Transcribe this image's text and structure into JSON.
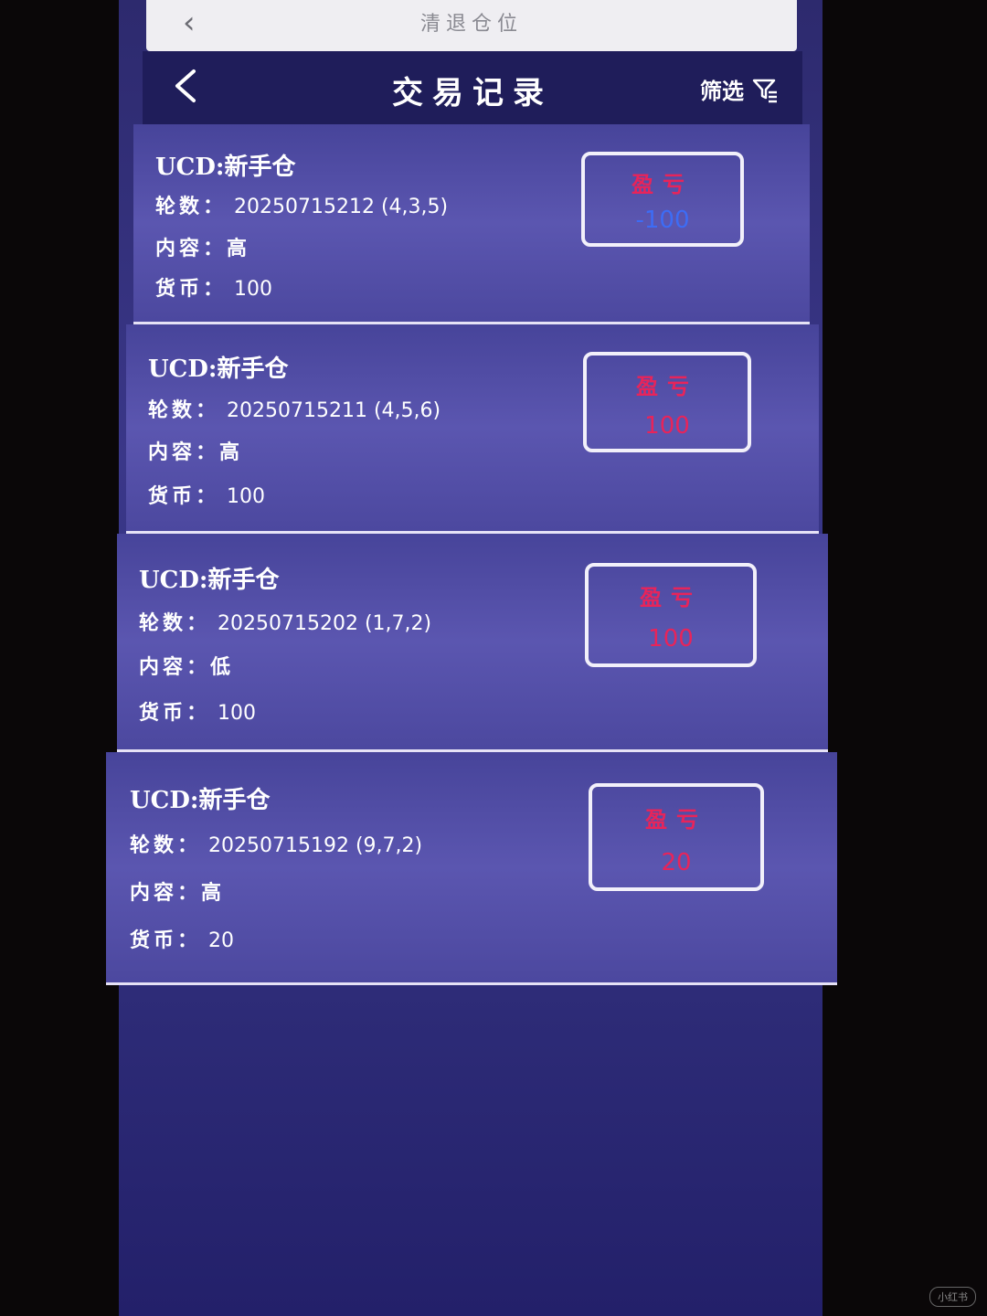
{
  "system_bar": {
    "back_icon": "chevron-left-icon",
    "title": "清退仓位"
  },
  "header": {
    "title": "交易记录",
    "filter_label": "筛选",
    "filter_icon": "filter-icon"
  },
  "records": [
    {
      "title": "UCD:新手仓",
      "round_label": "轮数：",
      "round_value": "20250715212 (4,3,5)",
      "content_label": "内容：",
      "content_value": "高",
      "currency_label": "货币：",
      "currency_value": "100",
      "pl_label": "盈亏",
      "pl_value": "-100",
      "pl_color": "#3d6cf5"
    },
    {
      "title": "UCD:新手仓",
      "round_label": "轮数：",
      "round_value": "20250715211 (4,5,6)",
      "content_label": "内容：",
      "content_value": "高",
      "currency_label": "货币：",
      "currency_value": "100",
      "pl_label": "盈亏",
      "pl_value": "100",
      "pl_color": "#e8245a"
    },
    {
      "title": "UCD:新手仓",
      "round_label": "轮数：",
      "round_value": "20250715202 (1,7,2)",
      "content_label": "内容：",
      "content_value": "低",
      "currency_label": "货币：",
      "currency_value": "100",
      "pl_label": "盈亏",
      "pl_value": "100",
      "pl_color": "#e8245a"
    },
    {
      "title": "UCD:新手仓",
      "round_label": "轮数：",
      "round_value": "20250715192 (9,7,2)",
      "content_label": "内容：",
      "content_value": "高",
      "currency_label": "货币：",
      "currency_value": "20",
      "pl_label": "盈亏",
      "pl_value": "20",
      "pl_color": "#e8245a"
    }
  ],
  "watermark": "小红书"
}
